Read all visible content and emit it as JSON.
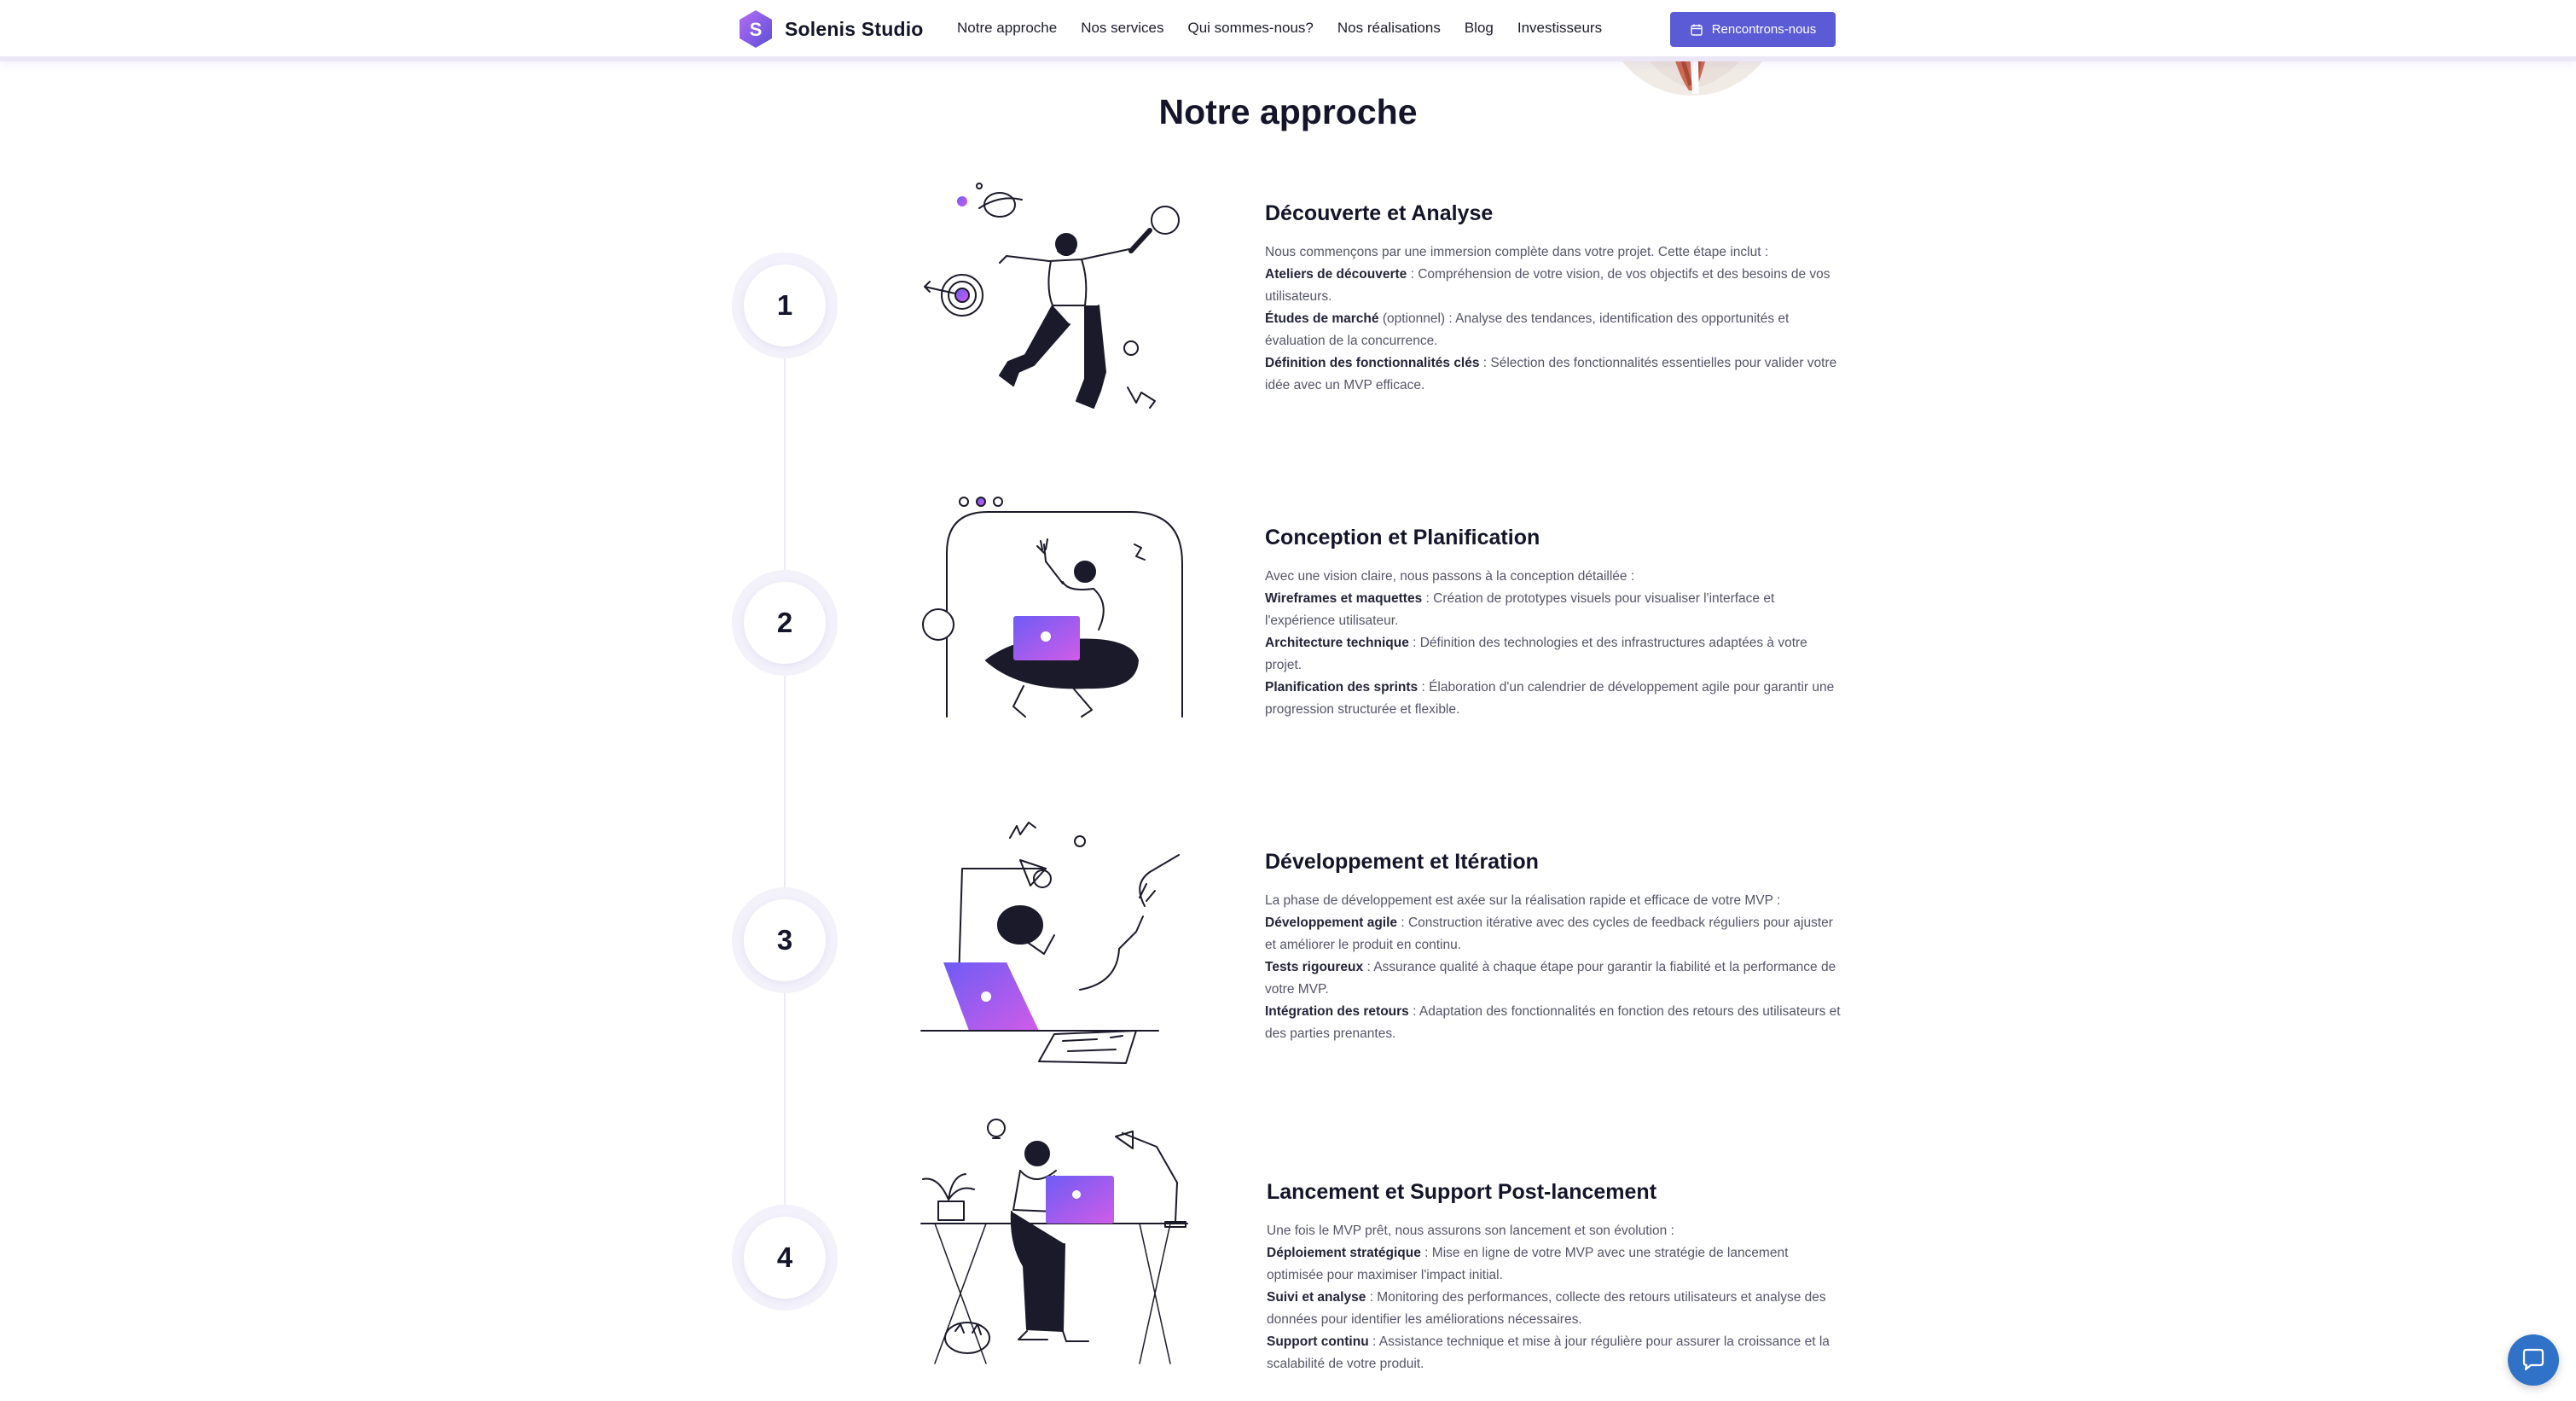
{
  "brand": {
    "name": "Solenis Studio",
    "mark_letter": "S"
  },
  "nav": [
    {
      "label": "Notre approche"
    },
    {
      "label": "Nos services"
    },
    {
      "label": "Qui sommes-nous?"
    },
    {
      "label": "Nos réalisations"
    },
    {
      "label": "Blog"
    },
    {
      "label": "Investisseurs"
    }
  ],
  "cta": {
    "label": "Rencontrons-nous",
    "icon": "calendar-icon"
  },
  "section": {
    "title": "Notre approche"
  },
  "steps": [
    {
      "number": "1",
      "title": "Découverte et Analyse",
      "intro": "Nous commençons par une immersion complète dans votre projet. Cette étape inclut :",
      "items": [
        {
          "term": "Ateliers de découverte",
          "sep": " : ",
          "text": "Compréhension de votre vision, de vos objectifs et des besoins de vos utilisateurs."
        },
        {
          "term": "Études de marché",
          "sep": " (optionnel) : ",
          "text": "Analyse des tendances, identification des opportunités et évaluation de la concurrence."
        },
        {
          "term": "Définition des fonctionnalités clés",
          "sep": " : ",
          "text": "Sélection des fonctionnalités essentielles pour valider votre idée avec un MVP efficace."
        }
      ]
    },
    {
      "number": "2",
      "title": "Conception et Planification",
      "intro": "Avec une vision claire, nous passons à la conception détaillée :",
      "items": [
        {
          "term": "Wireframes et maquettes",
          "sep": " : ",
          "text": "Création de prototypes visuels pour visualiser l'interface et l'expérience utilisateur."
        },
        {
          "term": "Architecture technique",
          "sep": " : ",
          "text": "Définition des technologies et des infrastructures adaptées à votre projet."
        },
        {
          "term": "Planification des sprints",
          "sep": " : ",
          "text": "Élaboration d'un calendrier de développement agile pour garantir une progression structurée et flexible."
        }
      ]
    },
    {
      "number": "3",
      "title": "Développement et Itération",
      "intro": "La phase de développement est axée sur la réalisation rapide et efficace de votre MVP :",
      "items": [
        {
          "term": "Développement agile",
          "sep": " : ",
          "text": "Construction itérative avec des cycles de feedback réguliers pour ajuster et améliorer le produit en continu."
        },
        {
          "term": "Tests rigoureux",
          "sep": " : ",
          "text": "Assurance qualité à chaque étape pour garantir la fiabilité et la performance de votre MVP."
        },
        {
          "term": "Intégration des retours",
          "sep": " : ",
          "text": "Adaptation des fonctionnalités en fonction des retours des utilisateurs et des parties prenantes."
        }
      ]
    },
    {
      "number": "4",
      "title": "Lancement et Support Post-lancement",
      "intro": "Une fois le MVP prêt, nous assurons son lancement et son évolution :",
      "items": [
        {
          "term": "Déploiement stratégique",
          "sep": " : ",
          "text": "Mise en ligne de votre MVP avec une stratégie de lancement optimisée pour maximiser l'impact initial."
        },
        {
          "term": "Suivi et analyse",
          "sep": " : ",
          "text": "Monitoring des performances, collecte des retours utilisateurs et analyse des données pour identifier les améliorations nécessaires."
        },
        {
          "term": "Support continu",
          "sep": " : ",
          "text": "Assistance technique et mise à jour régulière pour assurer la croissance et la scalabilité de votre produit."
        }
      ]
    }
  ],
  "chat": {
    "icon": "chat-bubble-icon"
  },
  "colors": {
    "accent": "#5b5bd6",
    "brand_purple": "#7b5cf0",
    "brand_pink": "#d65ce0",
    "chat_blue": "#2f72c8"
  }
}
